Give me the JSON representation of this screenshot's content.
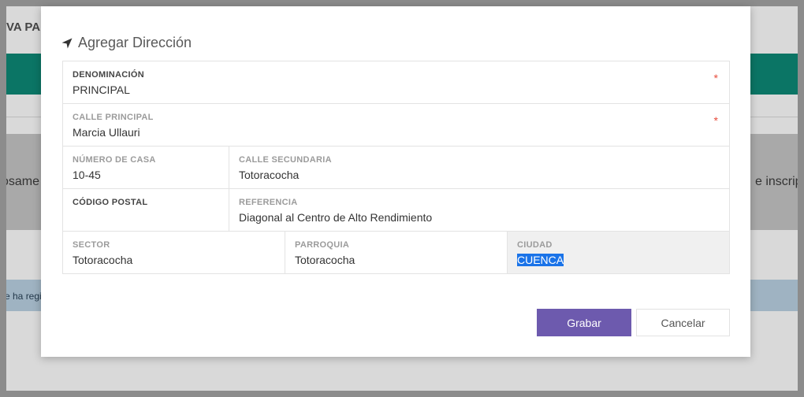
{
  "background": {
    "page_title": "VA PA",
    "left_text": "osame",
    "right_text": "e inscrip",
    "alert_text": "e ha regi"
  },
  "modal": {
    "title": "Agregar Dirección",
    "title_icon": "location-arrow-icon",
    "fields": {
      "denominacion": {
        "label": "DENOMINACIÓN",
        "value": "PRINCIPAL",
        "required_mark": "*"
      },
      "calle_principal": {
        "label": "CALLE PRINCIPAL",
        "value": "Marcia Ullauri",
        "required_mark": "*"
      },
      "numero_casa": {
        "label": "NÚMERO DE CASA",
        "value": "10-45"
      },
      "calle_secundaria": {
        "label": "CALLE SECUNDARIA",
        "value": "Totoracocha"
      },
      "codigo_postal": {
        "label": "CÓDIGO POSTAL",
        "value": ""
      },
      "referencia": {
        "label": "REFERENCIA",
        "value": "Diagonal al Centro de Alto Rendimiento"
      },
      "sector": {
        "label": "SECTOR",
        "value": "Totoracocha"
      },
      "parroquia": {
        "label": "PARROQUIA",
        "value": "Totoracocha"
      },
      "ciudad": {
        "label": "CIUDAD",
        "value": "CUENCA"
      }
    },
    "buttons": {
      "save": "Grabar",
      "cancel": "Cancelar"
    }
  },
  "colors": {
    "accent_teal": "#0b7565",
    "save_button": "#6d5aae",
    "required": "#e74c3c",
    "selection": "#1a73e8"
  }
}
